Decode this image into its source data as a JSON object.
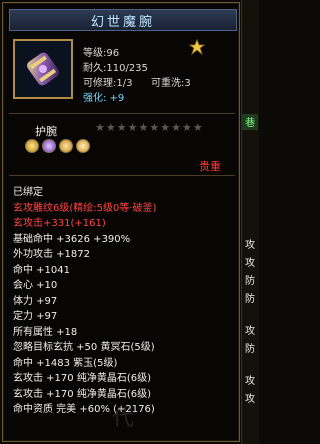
{
  "item": {
    "title": "幻世魔腕",
    "level": "等级:96",
    "durability": "耐久:110/235",
    "repairable": "可修理:1/3",
    "rewashable": "可重洗:3",
    "strengthen": "强化: +9",
    "slot": "护腕",
    "stars_total": 10,
    "stars_filled": 0,
    "expensive_label": "贵重"
  },
  "attributes": [
    {
      "text": "已绑定",
      "class": "c-white"
    },
    {
      "text": "玄攻雕纹6级(精绘:5级0等·破釜)",
      "class": "c-red"
    },
    {
      "text": "玄攻击+331(+161)",
      "class": "c-red"
    },
    {
      "text": "基础命中 +3626 +390%",
      "class": "c-white"
    },
    {
      "text": "外功攻击 +1872",
      "class": "c-white"
    },
    {
      "text": "命中 +1041",
      "class": "c-white"
    },
    {
      "text": "会心 +10",
      "class": "c-white"
    },
    {
      "text": "体力 +97",
      "class": "c-white"
    },
    {
      "text": "定力 +97",
      "class": "c-white"
    },
    {
      "text": "所有属性 +18",
      "class": "c-white"
    },
    {
      "text": "忽略目标玄抗 +50 黄冥石(5级)",
      "class": "c-white"
    },
    {
      "text": "命中 +1483 紫玉(5级)",
      "class": "c-white"
    },
    {
      "text": "玄攻击 +170 纯净黄晶石(6级)",
      "class": "c-white"
    },
    {
      "text": "玄攻击 +170 纯净黄晶石(6级)",
      "class": "c-white"
    },
    {
      "text": "命中资质 完美 +60% (+2176)",
      "class": "c-green"
    }
  ],
  "right_panel": [
    "巷",
    "攻",
    "攻",
    "防",
    "防",
    "攻",
    "防",
    "攻",
    "攻"
  ],
  "colors": {
    "border": "#6a5a3a",
    "title": "#bfe4ff",
    "red": "#ff4444",
    "green": "#3fe05a",
    "strengthen": "#6fd8ff"
  },
  "watermark": "代"
}
